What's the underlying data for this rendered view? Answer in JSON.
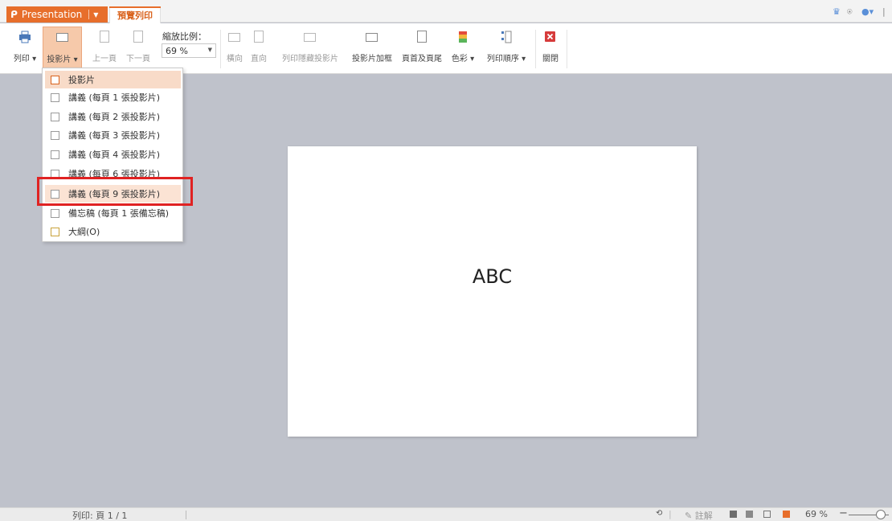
{
  "titlebar": {
    "app_name": "Presentation",
    "tab_label": "預覽列印"
  },
  "ribbon": {
    "print_label": "列印",
    "slides_label": "投影片",
    "prev_page_label": "上一頁",
    "next_page_label": "下一頁",
    "zoom_label": "縮放比例：",
    "zoom_value": "69 %",
    "landscape_label": "橫向",
    "portrait_label": "直向",
    "print_hidden_label": "列印隱藏投影片",
    "frame_slides_label": "投影片加框",
    "header_footer_label": "頁首及頁尾",
    "color_label": "色彩",
    "print_order_label": "列印順序",
    "close_label": "關閉"
  },
  "dropdown": {
    "items": [
      {
        "label": "投影片"
      },
      {
        "label": "講義 (每頁 1 張投影片)"
      },
      {
        "label": "講義 (每頁 2 張投影片)"
      },
      {
        "label": "講義 (每頁 3 張投影片)"
      },
      {
        "label": "講義 (每頁 4 張投影片)"
      },
      {
        "label": "講義 (每頁 6 張投影片)"
      },
      {
        "label": "講義 (每頁 9 張投影片)"
      },
      {
        "label": "備忘稿 (每頁 1 張備忘稿)"
      },
      {
        "label": "大綱(O)"
      }
    ]
  },
  "slide": {
    "text": "ABC"
  },
  "statusbar": {
    "page_info": "列印: 頁 1 / 1",
    "notes_label": "註解",
    "zoom_pct": "69 %"
  },
  "colors": {
    "accent": "#e76e2b",
    "highlight_box": "#e02222",
    "canvas_bg": "#bfc2cb"
  }
}
